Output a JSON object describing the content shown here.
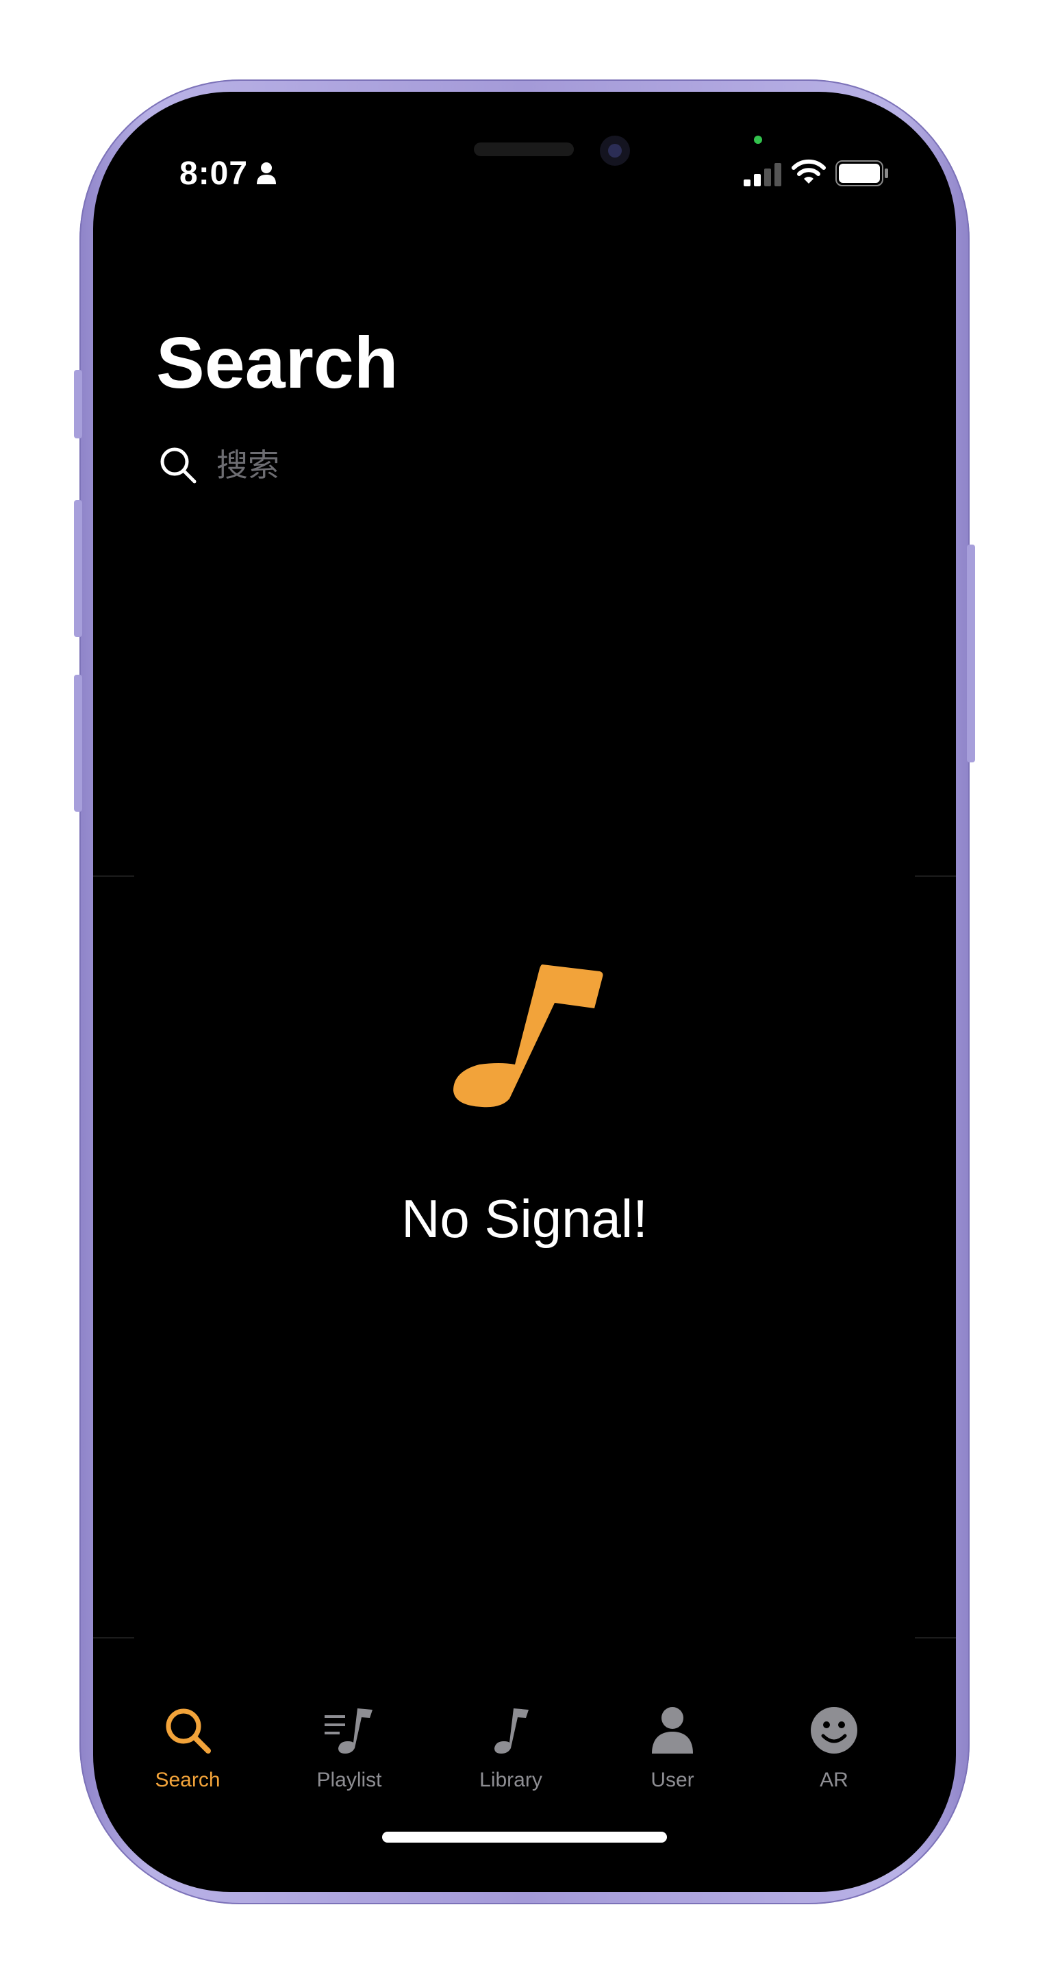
{
  "status_bar": {
    "time": "8:07"
  },
  "header": {
    "title": "Search"
  },
  "search": {
    "placeholder": "搜索"
  },
  "empty_state": {
    "message": "No Signal!",
    "icon": "music-note-icon",
    "accent_color": "#f2a33a"
  },
  "tab_bar": {
    "active_color": "#f2a33a",
    "inactive_color": "#8e8e93",
    "tabs": [
      {
        "label": "Search",
        "icon": "magnifier-icon",
        "active": true
      },
      {
        "label": "Playlist",
        "icon": "playlist-icon",
        "active": false
      },
      {
        "label": "Library",
        "icon": "music-note-icon",
        "active": false
      },
      {
        "label": "User",
        "icon": "person-icon",
        "active": false
      },
      {
        "label": "AR",
        "icon": "smiley-icon",
        "active": false
      }
    ]
  },
  "device": {
    "frame_color": "#a49ad8"
  }
}
